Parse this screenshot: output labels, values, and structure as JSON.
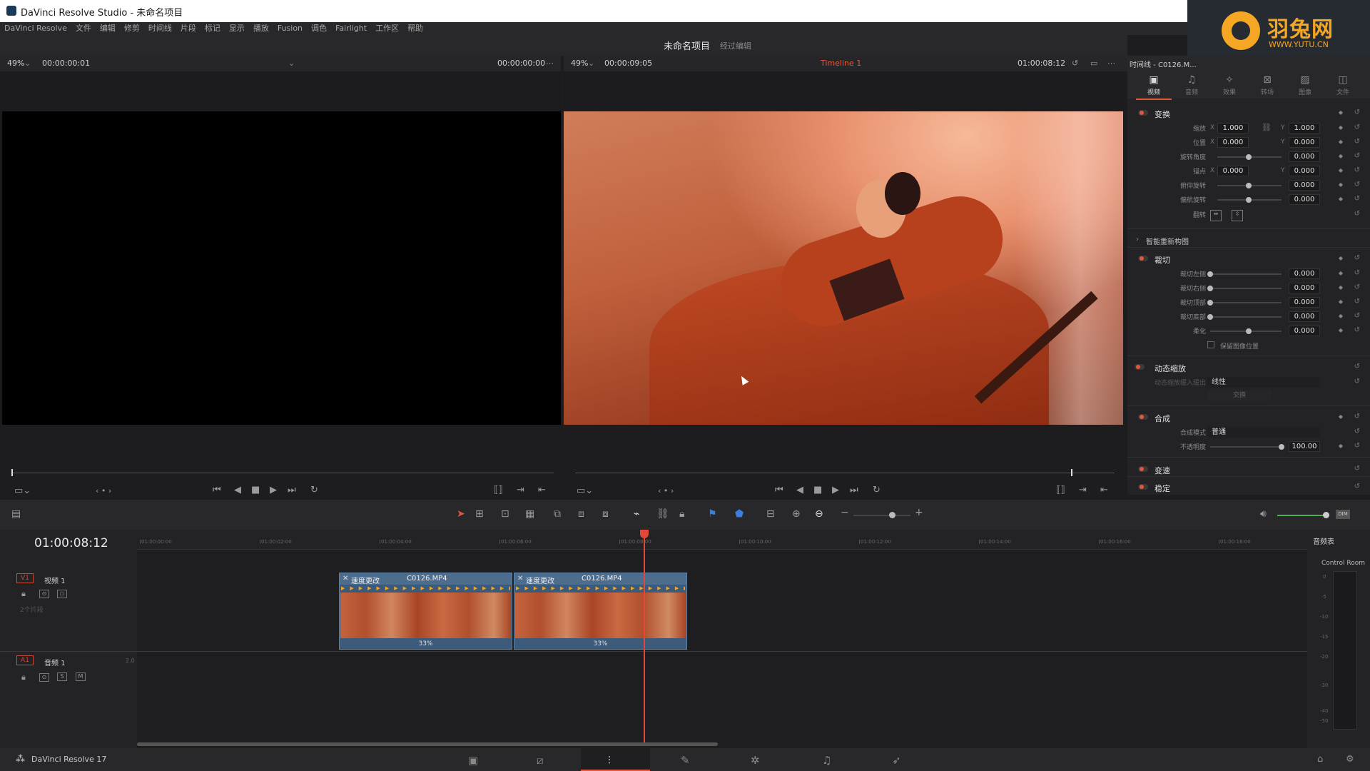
{
  "window": {
    "title": "DaVinci Resolve Studio - 未命名项目"
  },
  "watermark": {
    "cn": "羽兔网",
    "en": "WWW.YUTU.CN"
  },
  "menu": [
    "DaVinci Resolve",
    "文件",
    "编辑",
    "修剪",
    "时间线",
    "片段",
    "标记",
    "显示",
    "播放",
    "Fusion",
    "调色",
    "Fairlight",
    "工作区",
    "帮助"
  ],
  "project": {
    "name": "未命名项目",
    "status": "经过编辑"
  },
  "source_viewer": {
    "zoom": "49%",
    "timecode": "00:00:00:01",
    "right_tc": "00:00:00:00"
  },
  "timeline_viewer": {
    "zoom": "49%",
    "duration": "00:00:09:05",
    "timeline_name": "Timeline 1",
    "timecode": "01:00:08:12"
  },
  "inspector": {
    "header": "时间线 - C0126.M...",
    "tabs": [
      {
        "label": "视频",
        "icon": "video-icon",
        "active": true
      },
      {
        "label": "音频",
        "icon": "audio-icon",
        "active": false
      },
      {
        "label": "效果",
        "icon": "effects-icon",
        "active": false
      },
      {
        "label": "转场",
        "icon": "transition-icon",
        "active": false
      },
      {
        "label": "图像",
        "icon": "image-icon",
        "active": false
      },
      {
        "label": "文件",
        "icon": "file-icon",
        "active": false
      }
    ],
    "transform": {
      "title": "变换",
      "zoom_label": "缩放",
      "zoom_x": "1.000",
      "zoom_y": "1.000",
      "position_label": "位置",
      "position_x": "0.000",
      "position_y": "0.000",
      "rotation_label": "旋转角度",
      "rotation": "0.000",
      "anchor_label": "锚点",
      "anchor_x": "0.000",
      "anchor_y": "0.000",
      "pitch_label": "俯仰旋转",
      "pitch": "0.000",
      "yaw_label": "偏航旋转",
      "yaw": "0.000",
      "flip_label": "翻转"
    },
    "smart_reframe": {
      "title": "智能重新构图"
    },
    "crop": {
      "title": "裁切",
      "left_label": "裁切左侧",
      "left": "0.000",
      "right_label": "裁切右侧",
      "right": "0.000",
      "top_label": "裁切顶部",
      "top": "0.000",
      "bottom_label": "裁切底部",
      "bottom": "0.000",
      "soft_label": "柔化",
      "soft": "0.000",
      "retain_label": "保留图像位置"
    },
    "dynamic_zoom": {
      "title": "动态缩放",
      "ease_label": "动态缩放缓入缓出",
      "ease_value": "线性",
      "swap_label": "交换"
    },
    "composite": {
      "title": "合成",
      "mode_label": "合成模式",
      "mode_value": "普通",
      "opacity_label": "不透明度",
      "opacity": "100.00"
    },
    "speed": {
      "title": "变速"
    },
    "stabilize": {
      "title": "稳定"
    }
  },
  "timeline": {
    "timecode": "01:00:08:12",
    "ruler": [
      "01:00:00:00",
      "01:00:02:00",
      "01:00:04:00",
      "01:00:06:00",
      "01:00:08:00",
      "01:00:10:00",
      "01:00:12:00",
      "01:00:14:00",
      "01:00:16:00",
      "01:00:18:00"
    ],
    "video_track": {
      "badge": "V1",
      "name": "视频 1",
      "clips_label": "2个片段"
    },
    "audio_track": {
      "badge": "A1",
      "name": "音频 1",
      "channels": "2.0",
      "solo": "S",
      "mute": "M"
    },
    "clips": [
      {
        "tag": "速度更改",
        "name": "C0126.MP4",
        "speed": "33%"
      },
      {
        "tag": "速度更改",
        "name": "C0126.MP4",
        "speed": "33%"
      }
    ]
  },
  "audio_panel": {
    "title": "音频表",
    "label": "Control Room",
    "scale": [
      "0",
      "-5",
      "-10",
      "-15",
      "-20",
      "-30",
      "-40",
      "-50"
    ]
  },
  "bottom": {
    "app_label": "DaVinci Resolve 17"
  },
  "colors": {
    "accent": "#e2593a",
    "clip": "#3c5a7a",
    "playhead": "#e0483a"
  }
}
